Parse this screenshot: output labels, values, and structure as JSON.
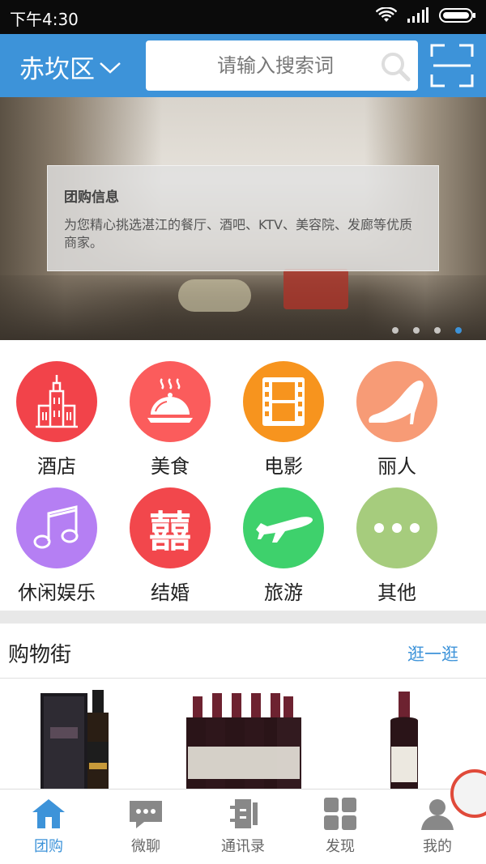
{
  "status_bar": {
    "time": "下午4:30"
  },
  "header": {
    "city": "赤坎区",
    "search_placeholder": "请输入搜索词"
  },
  "banner": {
    "title": "团购信息",
    "description": "为您精心挑选湛江的餐厅、酒吧、KTV、美容院、发廊等优质商家。",
    "page_count": 4,
    "active_page": 4
  },
  "categories": [
    {
      "label": "酒店",
      "icon": "hotel-building-icon",
      "color": "#f2434a"
    },
    {
      "label": "美食",
      "icon": "food-dish-icon",
      "color": "#fb5c5c"
    },
    {
      "label": "电影",
      "icon": "film-icon",
      "color": "#f7941e"
    },
    {
      "label": "丽人",
      "icon": "high-heel-icon",
      "color": "#f79b76"
    },
    {
      "label": "休闲娱乐",
      "icon": "music-note-icon",
      "color": "#b57ff3"
    },
    {
      "label": "结婚",
      "icon": "double-happiness-icon",
      "color": "#f2474c",
      "glyph": "囍"
    },
    {
      "label": "旅游",
      "icon": "airplane-icon",
      "color": "#3ed16c"
    },
    {
      "label": "其他",
      "icon": "more-dots-icon",
      "color": "#a6cc7d"
    }
  ],
  "shopping": {
    "title": "购物街",
    "more_label": "逛一逛"
  },
  "tabs": [
    {
      "label": "团购",
      "icon": "home-icon",
      "active": true
    },
    {
      "label": "微聊",
      "icon": "chat-icon",
      "active": false
    },
    {
      "label": "通讯录",
      "icon": "contacts-icon",
      "active": false
    },
    {
      "label": "发现",
      "icon": "grid-icon",
      "active": false
    },
    {
      "label": "我的",
      "icon": "profile-icon",
      "active": false
    }
  ],
  "colors": {
    "brand_blue": "#3d93d9"
  }
}
